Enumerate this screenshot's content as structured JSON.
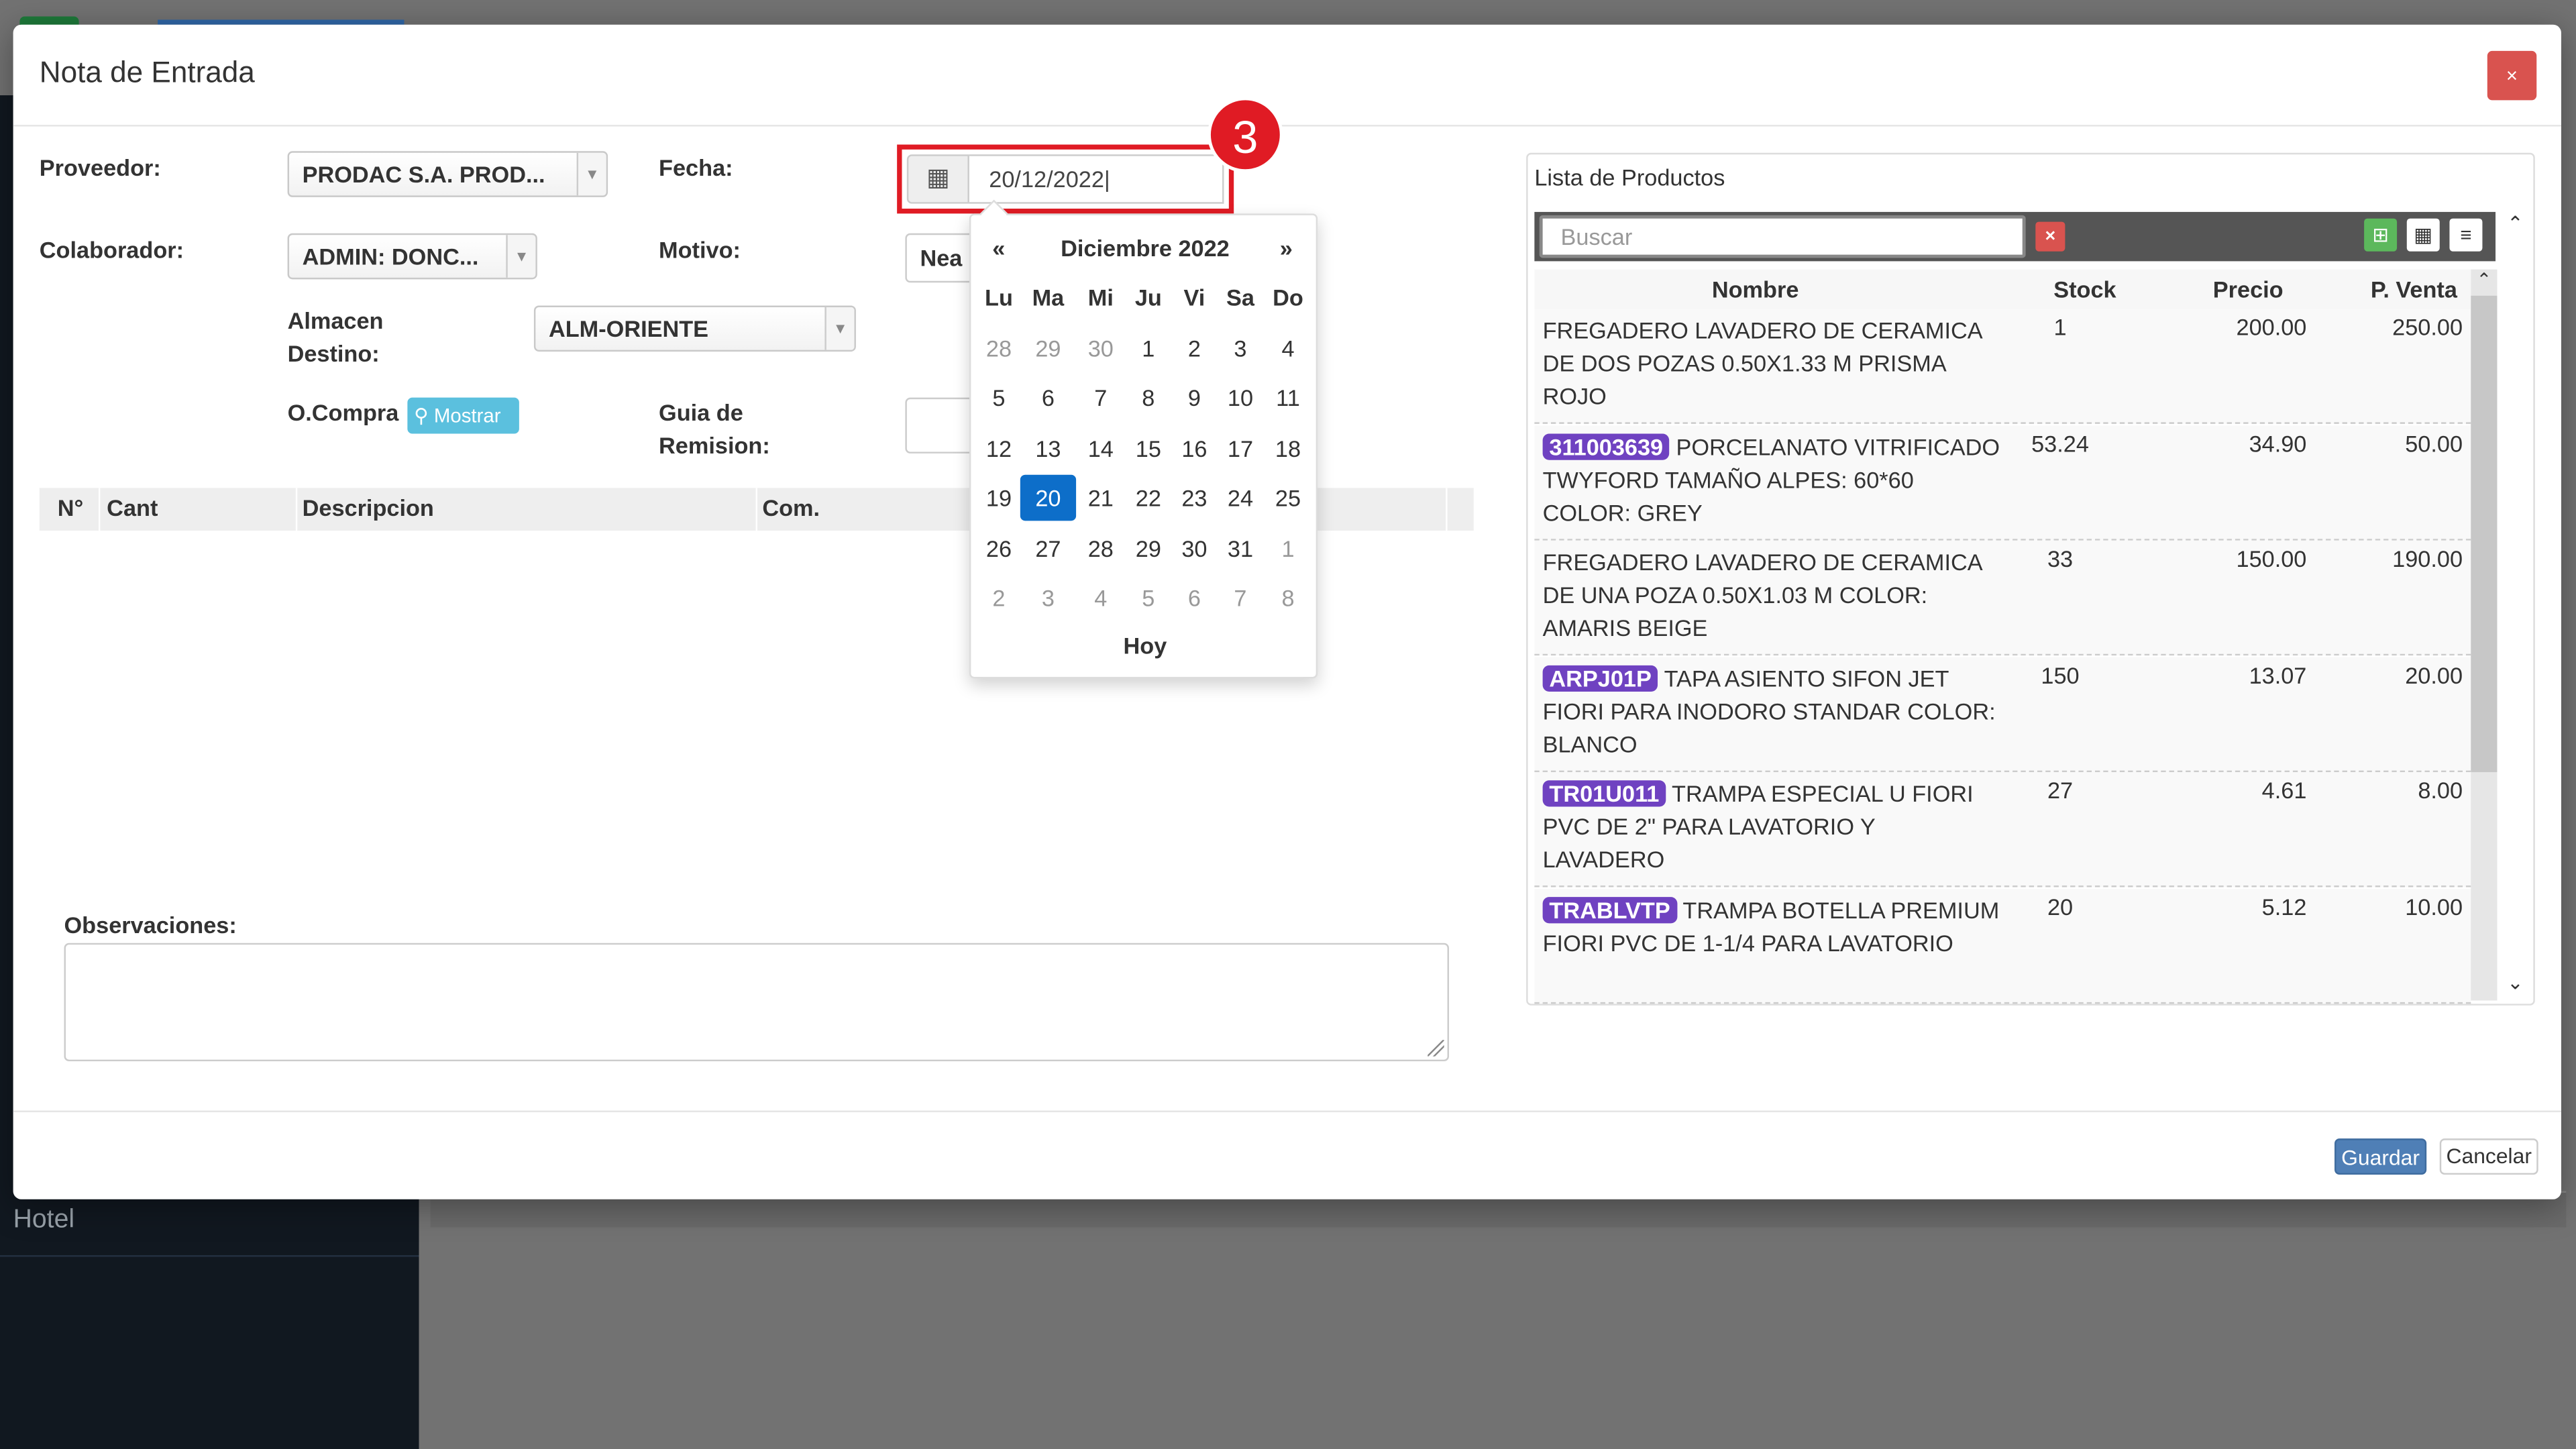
{
  "background": {
    "sidebar_item": "Hotel"
  },
  "modal": {
    "title": "Nota de Entrada",
    "close_label": "×",
    "labels": {
      "proveedor": "Proveedor:",
      "colaborador": "Colaborador:",
      "almacen_line1": "Almacen",
      "almacen_line2": "Destino:",
      "ocompra": "O.Compra",
      "fecha": "Fecha:",
      "motivo": "Motivo:",
      "guia_line1": "Guia de",
      "guia_line2": "Remision:",
      "observaciones": "Observaciones:"
    },
    "fields": {
      "proveedor": "PRODAC S.A. PROD...",
      "colaborador": "ADMIN: DONC...",
      "almacen": "ALM-ORIENTE",
      "motivo": "Nea",
      "fecha": "20/12/2022",
      "mostrar": "Mostrar"
    },
    "step_marker": "3",
    "grid_columns": [
      "N°",
      "Cant",
      "Descripcion",
      "Com."
    ],
    "footer": {
      "guardar": "Guardar",
      "cancelar": "Cancelar"
    }
  },
  "datepicker": {
    "prev": "«",
    "next": "»",
    "month_label": "Diciembre 2022",
    "weekdays": [
      "Lu",
      "Ma",
      "Mi",
      "Ju",
      "Vi",
      "Sa",
      "Do"
    ],
    "weeks": [
      [
        "28",
        "29",
        "30",
        "1",
        "2",
        "3",
        "4"
      ],
      [
        "5",
        "6",
        "7",
        "8",
        "9",
        "10",
        "11"
      ],
      [
        "12",
        "13",
        "14",
        "15",
        "16",
        "17",
        "18"
      ],
      [
        "19",
        "20",
        "21",
        "22",
        "23",
        "24",
        "25"
      ],
      [
        "26",
        "27",
        "28",
        "29",
        "30",
        "31",
        "1"
      ],
      [
        "2",
        "3",
        "4",
        "5",
        "6",
        "7",
        "8"
      ]
    ],
    "selected": "20",
    "today_label": "Hoy"
  },
  "products": {
    "title": "Lista de Productos",
    "search_placeholder": "Buscar",
    "clear_label": "×",
    "columns": [
      "Nombre",
      "Stock",
      "Precio",
      "P. Venta"
    ],
    "rows": [
      {
        "code": "",
        "name": "FREGADERO LAVADERO DE CERAMICA DE DOS POZAS 0.50X1.33 M PRISMA ROJO",
        "stock": "1",
        "price": "200.00",
        "sale": "250.00"
      },
      {
        "code": "311003639",
        "name": "PORCELANATO VITRIFICADO TWYFORD TAMAÑO ALPES: 60*60 COLOR: GREY",
        "stock": "53.24",
        "price": "34.90",
        "sale": "50.00"
      },
      {
        "code": "",
        "name": "FREGADERO LAVADERO DE CERAMICA DE UNA POZA 0.50X1.03 M COLOR: AMARIS BEIGE",
        "stock": "33",
        "price": "150.00",
        "sale": "190.00"
      },
      {
        "code": "ARPJ01P",
        "name": "TAPA ASIENTO SIFON JET FIORI PARA INODORO STANDAR COLOR: BLANCO",
        "stock": "150",
        "price": "13.07",
        "sale": "20.00"
      },
      {
        "code": "TR01U011",
        "name": "TRAMPA ESPECIAL U FIORI PVC DE 2\" PARA LAVATORIO Y LAVADERO",
        "stock": "27",
        "price": "4.61",
        "sale": "8.00"
      },
      {
        "code": "TRABLVTP",
        "name": "TRAMPA BOTELLA PREMIUM FIORI PVC DE 1-1/4 PARA LAVATORIO",
        "stock": "20",
        "price": "5.12",
        "sale": "10.00"
      }
    ]
  }
}
